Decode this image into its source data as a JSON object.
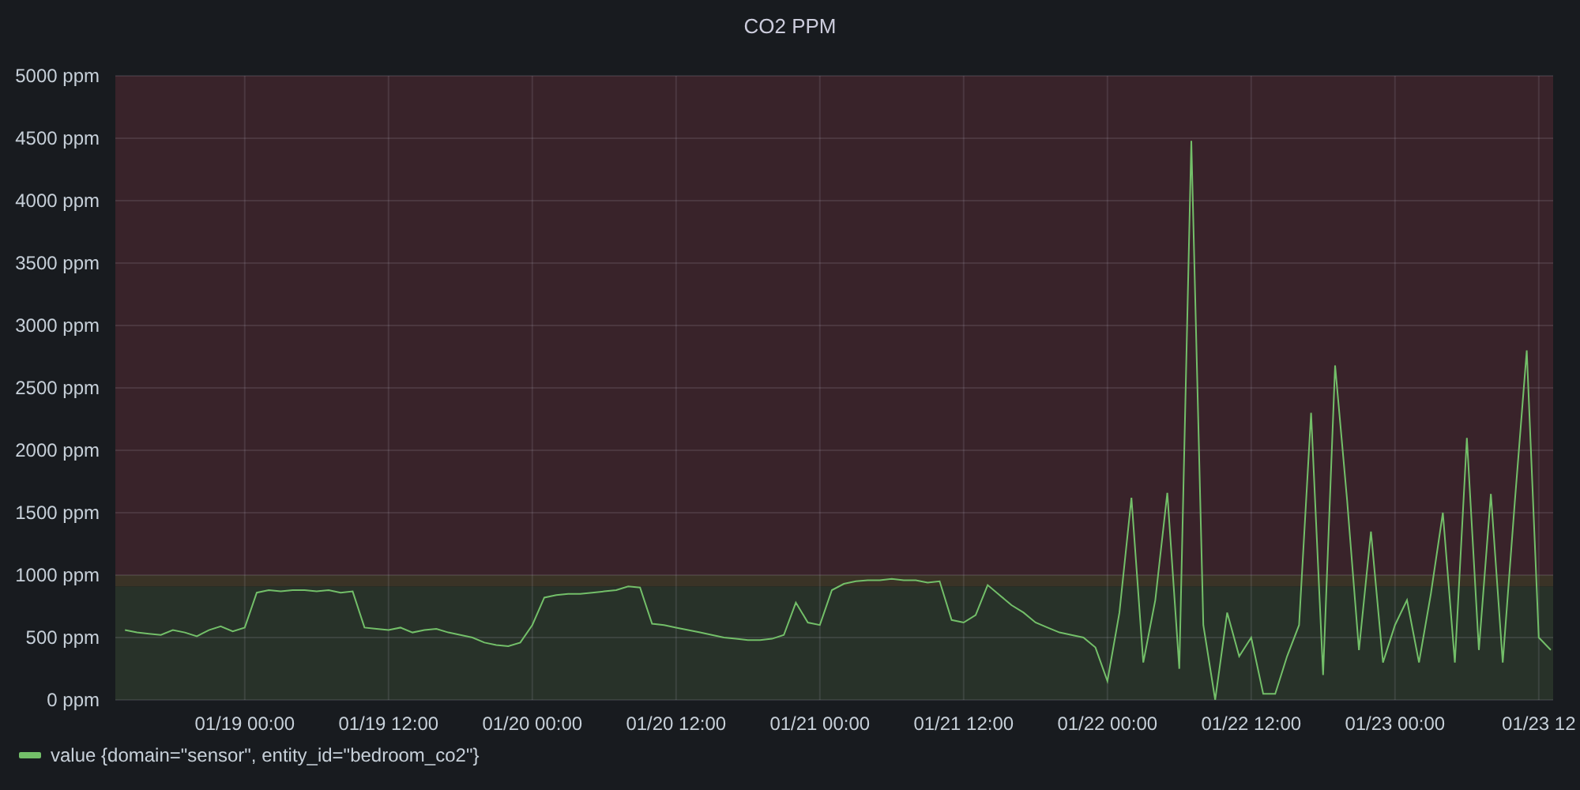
{
  "panel": {
    "chart_data": {
      "type": "line",
      "title": "CO2 PPM",
      "categories": [
        null,
        null,
        null,
        null,
        null,
        null,
        null,
        null,
        null,
        null,
        "01/19 00:00",
        null,
        null,
        null,
        null,
        null,
        null,
        null,
        null,
        null,
        null,
        null,
        "01/19 12:00",
        null,
        null,
        null,
        null,
        null,
        null,
        null,
        null,
        null,
        null,
        null,
        "01/20 00:00",
        null,
        null,
        null,
        null,
        null,
        null,
        null,
        null,
        null,
        null,
        null,
        "01/20 12:00",
        null,
        null,
        null,
        null,
        null,
        null,
        null,
        null,
        null,
        null,
        null,
        "01/21 00:00",
        null,
        null,
        null,
        null,
        null,
        null,
        null,
        null,
        null,
        null,
        null,
        "01/21 12:00",
        null,
        null,
        null,
        null,
        null,
        null,
        null,
        null,
        null,
        null,
        null,
        "01/22 00:00",
        null,
        null,
        null,
        null,
        null,
        null,
        null,
        null,
        null,
        null,
        null,
        "01/22 12:00",
        null,
        null,
        null,
        null,
        null,
        null,
        null,
        null,
        null,
        null,
        null,
        "01/23 00:00",
        null,
        null,
        null,
        null,
        null,
        null,
        null,
        null,
        null,
        null,
        null,
        "01/23 12",
        null
      ],
      "series": [
        {
          "name": "value {domain=\"sensor\", entity_id=\"bedroom_co2\"}",
          "color": "#73bf69",
          "values": [
            560,
            540,
            530,
            520,
            560,
            540,
            510,
            560,
            590,
            550,
            580,
            860,
            880,
            870,
            880,
            880,
            870,
            880,
            860,
            870,
            580,
            570,
            560,
            580,
            540,
            560,
            570,
            540,
            520,
            500,
            460,
            440,
            430,
            460,
            600,
            820,
            840,
            850,
            850,
            860,
            870,
            880,
            910,
            900,
            610,
            600,
            580,
            560,
            540,
            520,
            500,
            490,
            480,
            480,
            490,
            520,
            780,
            620,
            600,
            880,
            930,
            950,
            960,
            960,
            970,
            960,
            960,
            940,
            950,
            640,
            620,
            680,
            920,
            840,
            760,
            700,
            620,
            580,
            540,
            520,
            500,
            420,
            150,
            700,
            1620,
            300,
            800,
            1660,
            250,
            4480,
            600,
            0,
            700,
            350,
            500,
            50,
            50,
            350,
            600,
            2300,
            200,
            2680,
            1600,
            400,
            1350,
            300,
            600,
            800,
            300,
            850,
            1500,
            300,
            2100,
            400,
            1650,
            300,
            1580,
            2800,
            500,
            400
          ]
        }
      ],
      "ylim": [
        0,
        5000
      ],
      "grid": true,
      "yticks": [
        {
          "value": 0,
          "label": "0 ppm"
        },
        {
          "value": 500,
          "label": "500 ppm"
        },
        {
          "value": 1000,
          "label": "1000 ppm"
        },
        {
          "value": 1500,
          "label": "1500 ppm"
        },
        {
          "value": 2000,
          "label": "2000 ppm"
        },
        {
          "value": 2500,
          "label": "2500 ppm"
        },
        {
          "value": 3000,
          "label": "3000 ppm"
        },
        {
          "value": 3500,
          "label": "3500 ppm"
        },
        {
          "value": 4000,
          "label": "4000 ppm"
        },
        {
          "value": 4500,
          "label": "4500 ppm"
        },
        {
          "value": 5000,
          "label": "5000 ppm"
        }
      ],
      "bands": [
        {
          "axis": "y",
          "from": 0,
          "to": 910,
          "color": "#283229"
        },
        {
          "axis": "y",
          "from": 910,
          "to": 1000,
          "color": "#3a3326"
        },
        {
          "axis": "y",
          "from": 1000,
          "to": 5000,
          "color": "#39232a"
        }
      ]
    }
  }
}
